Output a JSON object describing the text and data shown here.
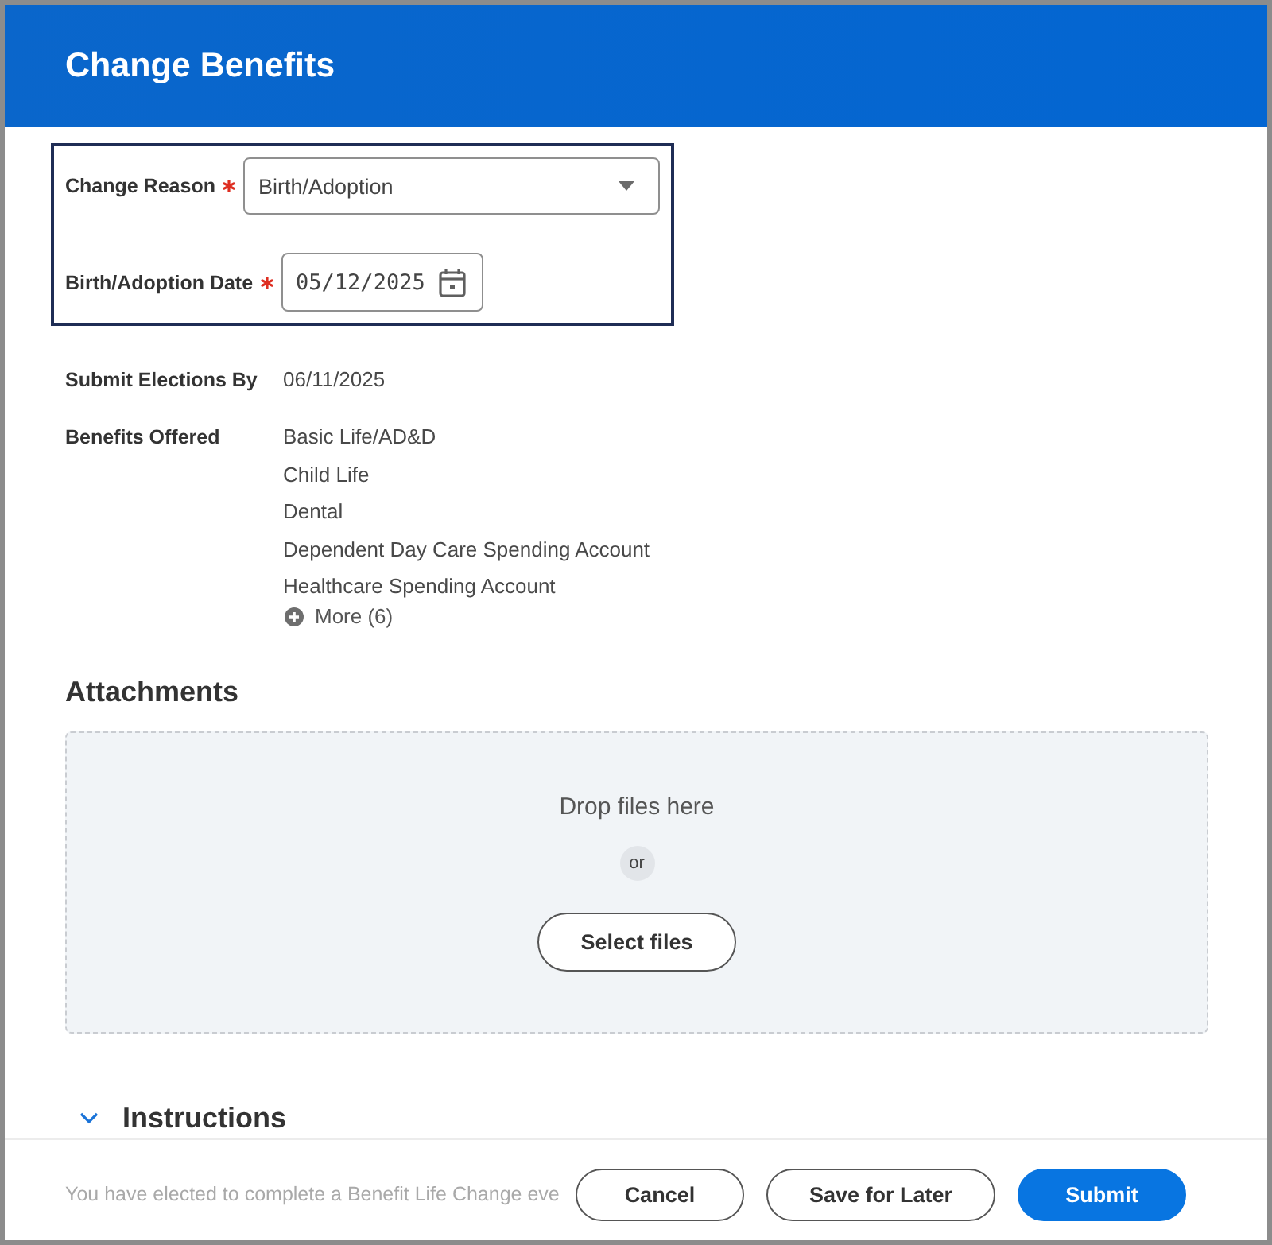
{
  "header": {
    "title": "Change Benefits"
  },
  "change_form": {
    "fields": [
      {
        "kind": "select",
        "label": "Change Reason",
        "required": true,
        "value": "Birth/Adoption"
      },
      {
        "kind": "date",
        "label": "Birth/Adoption Date",
        "required": true,
        "value": "05/12/2025"
      }
    ]
  },
  "details": [
    {
      "label": "Submit Elections By",
      "values": [
        "06/11/2025"
      ]
    },
    {
      "label": "Benefits Offered",
      "values": [
        "Basic Life/AD&D",
        "Child Life",
        "Dental",
        "Dependent Day Care Spending Account",
        "Healthcare Spending Account"
      ],
      "more": "More (6)"
    }
  ],
  "attachments": {
    "title": "Attachments",
    "drop_text": "Drop files here",
    "separator": "or",
    "button": "Select files"
  },
  "instructions": {
    "title": "Instructions",
    "expanded": true,
    "text": "You have elected to complete a Benefit Life Change eve"
  },
  "footer": {
    "buttons": [
      {
        "label": "Cancel",
        "kind": "secondary"
      },
      {
        "label": "Save for Later",
        "kind": "secondary"
      },
      {
        "label": "Submit",
        "kind": "primary"
      }
    ]
  }
}
